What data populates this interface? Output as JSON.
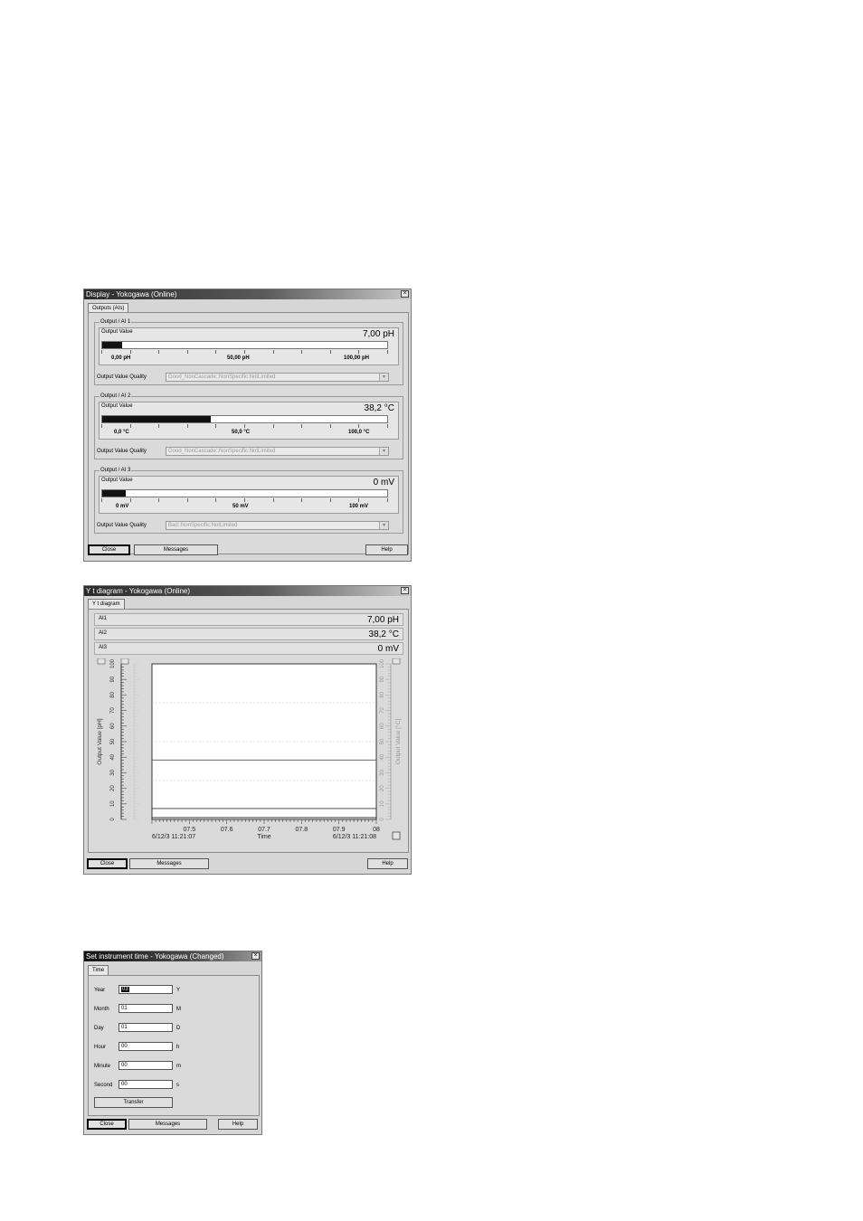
{
  "display_window": {
    "title": "Display - Yokogawa  (Online)",
    "tab": "Outputs (AIs)",
    "groups": [
      {
        "title": "Output / AI 1",
        "label": "Output Value",
        "value": "7,00 pH",
        "fill": 0.07,
        "scale": [
          "0,00 pH",
          "50,00 pH",
          "100,00 pH"
        ],
        "quality_label": "Output Value Quality",
        "quality": "Good_NonCascade::NonSpecific:NotLimited"
      },
      {
        "title": "Output / AI 2",
        "label": "Output Value",
        "value": "38,2 °C",
        "fill": 0.382,
        "scale": [
          "0,0 °C",
          "50,0 °C",
          "100,0 °C"
        ],
        "quality_label": "Output Value Quality",
        "quality": "Good_NonCascade::NonSpecific:NotLimited"
      },
      {
        "title": "Output / AI 3",
        "label": "Output Value",
        "value": "0 mV",
        "fill": 0.0,
        "scale": [
          "0 mV",
          "50 mV",
          "100 mV"
        ],
        "quality_label": "Output Value Quality",
        "quality": "Bad::NonSpecific:NotLimited"
      }
    ],
    "buttons": {
      "close": "Close",
      "messages": "Messages",
      "help": "Help"
    }
  },
  "yt_window": {
    "title": "Y t diagram - Yokogawa  (Online)",
    "tab": "Y t diagram",
    "rows": [
      {
        "name": "AI1",
        "value": "7,00 pH"
      },
      {
        "name": "AI2",
        "value": "38,2 °C"
      },
      {
        "name": "AI3",
        "value": "0 mV"
      }
    ],
    "buttons": {
      "close": "Close",
      "messages": "Messages",
      "help": "Help"
    }
  },
  "chart_data": {
    "type": "line",
    "title": "",
    "xlabel": "Time",
    "ylabel": "Output Value [pH]",
    "y2label": "Output Value [°C]",
    "ylim": [
      0,
      100
    ],
    "y_ticks": [
      0,
      10,
      20,
      30,
      40,
      50,
      60,
      70,
      80,
      90,
      100
    ],
    "xlim": [
      7.4,
      8.0
    ],
    "x_tick_labels": [
      "07.5",
      "07.6",
      "07.7",
      "07.8",
      "07.9",
      "08"
    ],
    "x_tick_values": [
      7.5,
      7.6,
      7.7,
      7.8,
      7.9,
      8.0
    ],
    "start_time": "6/12/3 11:21:07",
    "end_time": "6/12/3 11:21:08",
    "series": [
      {
        "values": [
          [
            7.4,
            7
          ],
          [
            8.0,
            7
          ]
        ],
        "color": "#333333"
      },
      {
        "values": [
          [
            7.4,
            38.2
          ],
          [
            8.0,
            38.2
          ]
        ],
        "color": "#555555"
      },
      {
        "values": [
          [
            7.4,
            0
          ],
          [
            8.0,
            0
          ]
        ],
        "color": "#333333"
      }
    ],
    "grid": true
  },
  "time_window": {
    "title": "Set instrument time - Yokogawa  (Changed)",
    "tab": "Time",
    "fields": [
      {
        "label": "Year",
        "value": "03",
        "unit": "Y"
      },
      {
        "label": "Month",
        "value": "01",
        "unit": "M"
      },
      {
        "label": "Day",
        "value": "01",
        "unit": "D"
      },
      {
        "label": "Hour",
        "value": "00",
        "unit": "h"
      },
      {
        "label": "Minute",
        "value": "00",
        "unit": "m"
      },
      {
        "label": "Second",
        "value": "00",
        "unit": "s"
      }
    ],
    "transfer": "Transfer",
    "buttons": {
      "close": "Close",
      "messages": "Messages",
      "help": "Help"
    }
  }
}
